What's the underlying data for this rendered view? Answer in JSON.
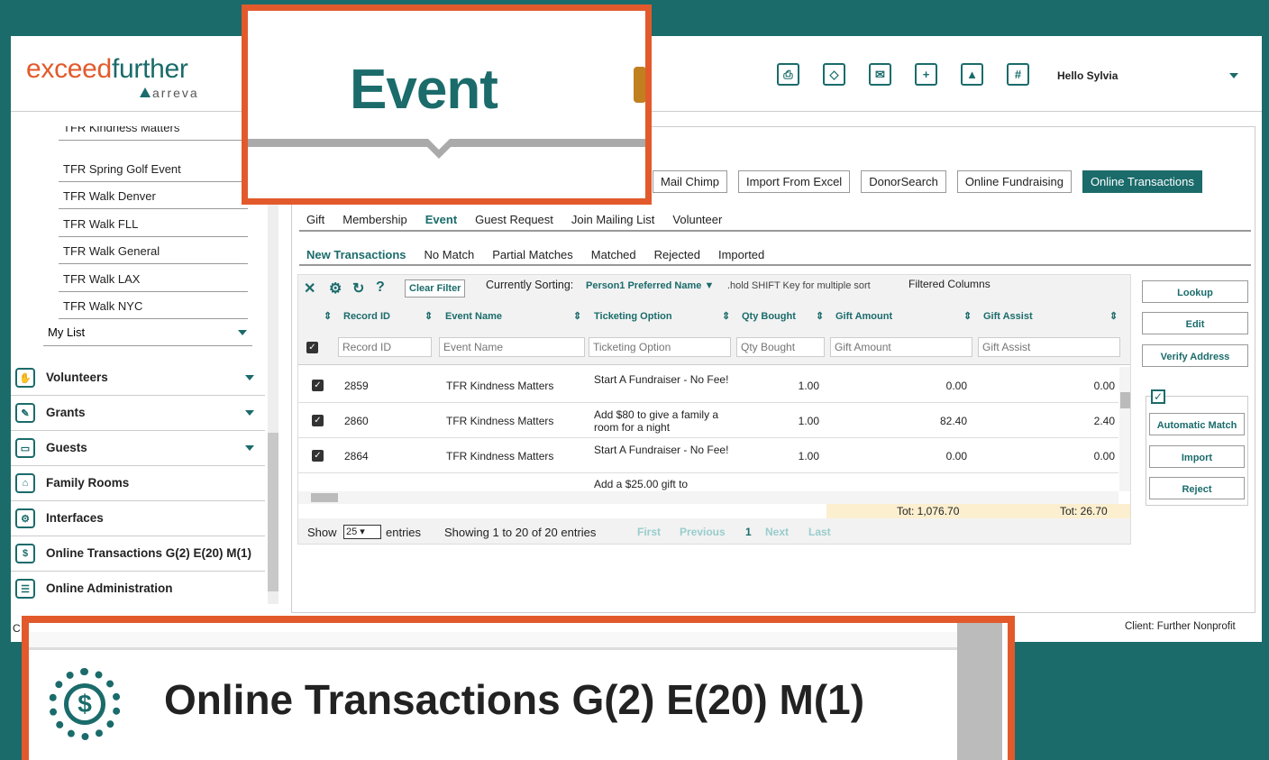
{
  "brand": {
    "logo_main_a": "exceed",
    "logo_main_b": "further",
    "logo_sub": "arreva"
  },
  "header": {
    "icons": [
      "printer-icon",
      "tag-icon",
      "mail-icon",
      "calendar-add-icon",
      "upload-icon",
      "grid-add-icon"
    ],
    "greeting": "Hello Sylvia"
  },
  "sidebar": {
    "sub_items": [
      "TFR Kindness Matters",
      "TFR Spring Golf Event",
      "TFR Walk Denver",
      "TFR Walk FLL",
      "TFR Walk General",
      "TFR Walk LAX",
      "TFR Walk NYC"
    ],
    "my_list": "My List",
    "sections": [
      {
        "label": "Volunteers",
        "icon": "hand-icon",
        "expandable": true
      },
      {
        "label": "Grants",
        "icon": "quill-icon",
        "expandable": true
      },
      {
        "label": "Guests",
        "icon": "bed-icon",
        "expandable": true
      },
      {
        "label": "Family Rooms",
        "icon": "house-people-icon",
        "expandable": false
      },
      {
        "label": "Interfaces",
        "icon": "gears-icon",
        "expandable": false
      },
      {
        "label": "Online Transactions G(2) E(20) M(1)",
        "icon": "dollar-cycle-icon",
        "expandable": false
      },
      {
        "label": "Online Administration",
        "icon": "admin-panel-icon",
        "expandable": false
      }
    ]
  },
  "top_buttons": [
    "Mail Chimp",
    "Import From Excel",
    "DonorSearch",
    "Online Fundraising",
    "Online Transactions"
  ],
  "tabs": [
    "Gift",
    "Membership",
    "Event",
    "Guest Request",
    "Join Mailing List",
    "Volunteer"
  ],
  "subtabs": [
    "New Transactions",
    "No Match",
    "Partial Matches",
    "Matched",
    "Rejected",
    "Imported"
  ],
  "toolbar": {
    "clear_filter": "Clear Filter",
    "sorting_label": "Currently Sorting:",
    "sorting_value": "Person1 Preferred Name ▼",
    "hold_hint": ".hold SHIFT Key for multiple sort",
    "filtered_columns": "Filtered Columns"
  },
  "table": {
    "columns": [
      "Record ID",
      "Event Name",
      "Ticketing Option",
      "Qty Bought",
      "Gift Amount",
      "Gift Assist"
    ],
    "placeholders": [
      "Record ID",
      "Event Name",
      "Ticketing Option",
      "Qty Bought",
      "Gift Amount",
      "Gift Assist"
    ],
    "rows": [
      {
        "record_id": "2859",
        "event": "TFR Kindness Matters",
        "ticket": "Start A Fundraiser - No Fee!",
        "qty": "1.00",
        "amount": "0.00",
        "assist": "0.00"
      },
      {
        "record_id": "2860",
        "event": "TFR Kindness Matters",
        "ticket": "Add $80 to give a family a room for a night",
        "qty": "1.00",
        "amount": "82.40",
        "assist": "2.40"
      },
      {
        "record_id": "2864",
        "event": "TFR Kindness Matters",
        "ticket": "Start A Fundraiser - No Fee!",
        "qty": "1.00",
        "amount": "0.00",
        "assist": "0.00"
      },
      {
        "record_id": "",
        "event": "",
        "ticket": "Add a $25.00 gift to",
        "qty": "",
        "amount": "",
        "assist": ""
      }
    ],
    "total_amount": "Tot: 1,076.70",
    "total_assist": "Tot: 26.70"
  },
  "footer": {
    "show": "Show",
    "page_size": "25",
    "entries": "entries",
    "showing": "Showing 1 to 20 of 20 entries",
    "first": "First",
    "previous": "Previous",
    "page": "1",
    "next": "Next",
    "last": "Last"
  },
  "right_buttons": {
    "lookup": "Lookup",
    "edit": "Edit",
    "verify": "Verify Address",
    "auto_match": "Automatic Match",
    "import": "Import",
    "reject": "Reject"
  },
  "client": {
    "left": "C",
    "right": "Client: Further Nonprofit"
  },
  "zoom": {
    "event": "Event",
    "online": "Online Transactions G(2) E(20) M(1)"
  },
  "colors": {
    "teal": "#1b6b6b",
    "orange": "#e25a2c",
    "background": "#1b6b6b"
  }
}
